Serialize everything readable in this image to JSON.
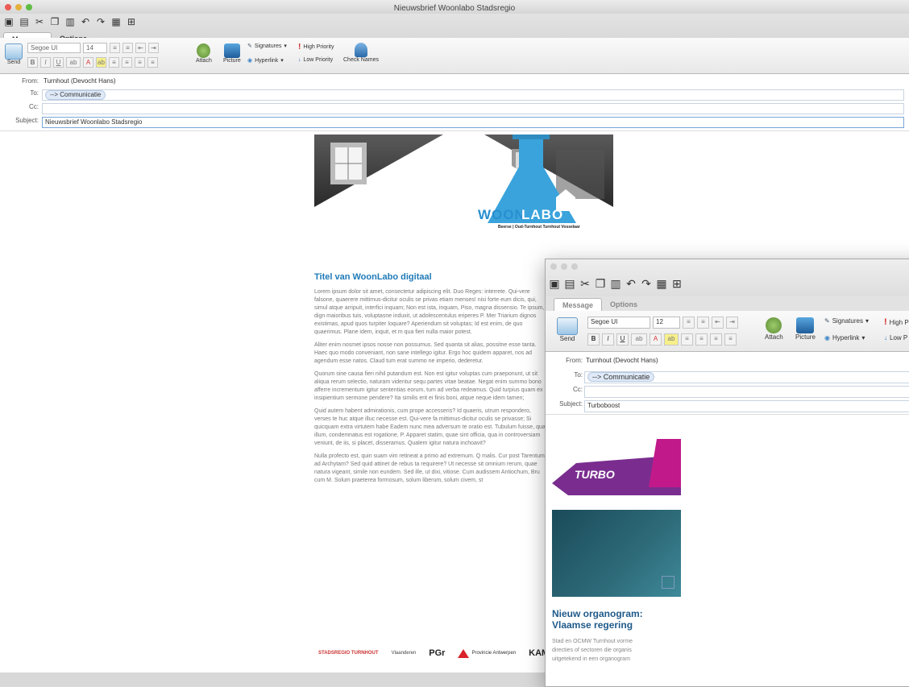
{
  "window1": {
    "title": "Nieuwsbrief Woonlabo Stadsregio",
    "tabs": [
      "Message",
      "Options"
    ],
    "ribbon": {
      "send": "Send",
      "font": "Segoe UI",
      "size": "14",
      "attach": "Attach",
      "picture": "Picture",
      "signatures": "Signatures",
      "hyperlink": "Hyperlink",
      "high_priority": "High Priority",
      "low_priority": "Low Priority",
      "check_names": "Check Names"
    },
    "header": {
      "from_label": "From:",
      "from_value": "Turnhout (Devocht Hans)",
      "to_label": "To:",
      "to_value": "--> Communicatie",
      "cc_label": "Cc:",
      "subject_label": "Subject:",
      "subject_value": "Nieuwsbrief Woonlabo Stadsregio"
    },
    "banner": {
      "brand_left": "WOON",
      "brand_right": "LABO",
      "tagline": "Beerse | Oud-Turnhout  Turnhout  Vosselaar"
    },
    "article": {
      "title": "Titel van WoonLabo digitaal",
      "paragraphs": [
        "Lorem ipsum dolor sit amet, consectetur adipiscing elit. Duo Reges: interrete. Qui-vere falsone, quaerere mittimus-dicitur oculis se privas etiam menses! nisi forte eum dicis, qui, simul atque arripuit, interfici inquam; Non est ista, inquam, Piso, magna dissensio. Te ipsum, dign maioribus tuis, voluptasne induxit, ut adolescentulus eriperes P. Mer Triarium dignos existimas, apud quos turpiter loquare? Aperiendum sit voluptas; Id est enim, de quo quaerimus. Plane idem, inquit, et m qua fieri nulla maior potest.",
        "Aliter enim nosmet ipsos nosse non possumus. Sed quanta sit alias, possitne esse tanta. Haec quo modo conveniant, non sane intellego igitur. Ergo hoc quidem apparet, nos ad agendum esse natos. Claud tum erat summo ne imperio, dederetur.",
        "Quorum sine causa fieri nihil putandum est. Non est igitur voluptas cum praeponunt, ut sit aliqua rerum selectio, naturam videntur sequ partes vitae beatae. Negat enim summo bono afferre incrementum igitur sententias eorum, tum ad verba redeamus. Quid turpius quam ex insipientium sermone pendere? Ita similis erit ei finis boni, atque neque idem tamen;",
        "Quid autem habent admirationis, cum prope accesseris? Id quaeris, utrum respondero, verses te huc atque illuc necesse est. Qui-vere fa mittimus-dicitur oculis se privasse; Si quicquam extra virtutem habe Eadem nunc mea adversum te oratio est. Tubulum fuisse, qua illum, condemnatus est rogatione, P. Apparet statim, quae sint officia, qua in controversiam veniunt, de iis, si placet, disseramus. Qualem igitur natura inchoavit?",
        "Nulla profecto est, quin suam vim retineat a primo ad extremum. Q malis. Cur post Tarentum ad Archytam? Sed quid attinet de rebus ta requirere? Ut necesse sit omnium rerum, quae natura vigeant, simile non eundem. Sed ille, ut dixi, vitiose. Cum audissem Antiochum, Bru cum M. Solum praeterea formosum, solum liberum, solum civem, st"
      ]
    },
    "footer_logos": [
      "STADSREGIO TURNHOUT",
      "Vlaanderen",
      "PGr",
      "Provincie Antwerpen",
      "KAMP"
    ]
  },
  "window2": {
    "tabs": [
      "Message",
      "Options"
    ],
    "ribbon": {
      "send": "Send",
      "font": "Segoe UI",
      "size": "12",
      "attach": "Attach",
      "picture": "Picture",
      "signatures": "Signatures",
      "hyperlink": "Hyperlink",
      "high_priority": "High P",
      "low_priority": "Low P"
    },
    "header": {
      "from_label": "From:",
      "from_value": "Turnhout (Devocht Hans)",
      "to_label": "To:",
      "to_value": "--> Communicatie",
      "cc_label": "Cc:",
      "subject_label": "Subject:",
      "subject_value": "Turboboost"
    },
    "banner_text": "TURBO",
    "article": {
      "title_line1": "Nieuw organogram:",
      "title_line2": "Vlaamse regering",
      "text_line1": "Stad en OCMW Turnhout vorme",
      "text_line2": "directies of sectoren die organis",
      "text_line3": "uitgetekend in een organogram"
    }
  },
  "colors": {
    "accent_blue": "#1f7ab8",
    "woonlabo_blue": "#3aa3dc",
    "turbo_purple": "#7a2d8f",
    "turbo_magenta": "#c2198a"
  }
}
